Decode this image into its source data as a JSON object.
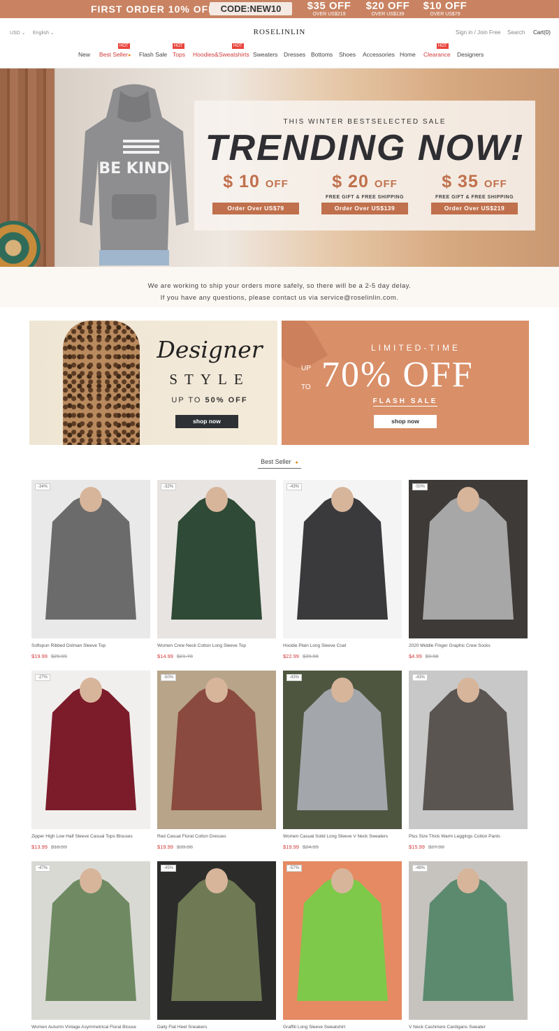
{
  "promo": {
    "first_order": "FIRST ORDER 10% OFF",
    "code": "CODE:NEW10",
    "offers": [
      {
        "amount": "$35 OFF",
        "condition": "OVER US$219"
      },
      {
        "amount": "$20 OFF",
        "condition": "OVER US$139"
      },
      {
        "amount": "$10 OFF",
        "condition": "OVER US$79"
      }
    ]
  },
  "header": {
    "currency": "USD",
    "language": "English",
    "logo": "ROSELINLIN",
    "signin": "Sign in / Join Free",
    "search": "Search",
    "cart": "Cart(0)"
  },
  "nav": {
    "items": [
      {
        "label": "New"
      },
      {
        "label": "Best Seller"
      },
      {
        "label": "Flash Sale"
      },
      {
        "label": "Tops"
      },
      {
        "label": "Hoodies&Sweatshirts"
      },
      {
        "label": "Sweaters"
      },
      {
        "label": "Dresses"
      },
      {
        "label": "Bottoms"
      },
      {
        "label": "Shoes"
      },
      {
        "label": "Accessories"
      },
      {
        "label": "Home"
      },
      {
        "label": "Clearance"
      },
      {
        "label": "Designers"
      }
    ],
    "hot_label": "HOT"
  },
  "hero": {
    "eyebrow": "THIS WINTER BESTSELECTED SALE",
    "title": "TRENDING NOW!",
    "hoodie_text": "BE KIND",
    "deals": [
      {
        "amount": "$ 10",
        "unit": "OFF",
        "note": "",
        "button": "Order Over US$79"
      },
      {
        "amount": "$ 20",
        "unit": "OFF",
        "note": "FREE GIFT & FREE SHIPPING",
        "button": "Order Over US$139"
      },
      {
        "amount": "$ 35",
        "unit": "OFF",
        "note": "FREE GIFT & FREE SHIPPING",
        "button": "Order Over US$219"
      }
    ]
  },
  "notice": {
    "line1": "We are working to ship your orders more safely, so there will be a 2-5 day delay.",
    "line2": "If you have any questions, please contact us via service@roselinlin.com."
  },
  "banner_left": {
    "script": "Designer",
    "style": "STYLE",
    "upto": "UP TO",
    "percent": "50% OFF",
    "button": "shop now"
  },
  "banner_right": {
    "limited": "LIMITED-TIME",
    "up": "UP",
    "to": "TO",
    "percent": "70% OFF",
    "flash": "FLASH SALE",
    "button": "shop now"
  },
  "best_seller": {
    "title": "Best Seller"
  },
  "products": [
    {
      "discount": "-34%",
      "name": "Softspun Ribbed Dolman Sleeve Top",
      "price": "$19.99",
      "old": "$29.99",
      "color": "#6b6b6b",
      "bg": "#e9e9e9"
    },
    {
      "discount": "-32%",
      "name": "Women Crew Neck Cotton Long Sleeve Top",
      "price": "$14.99",
      "old": "$21.78",
      "color": "#2f4a36",
      "bg": "#e8e4e2"
    },
    {
      "discount": "-43%",
      "name": "Hoodie Plain Long Sleeve Coat",
      "price": "$22.99",
      "old": "$39.98",
      "color": "#3a3a3c",
      "bg": "#f4f4f4"
    },
    {
      "discount": "-50%",
      "name": "2020 Middle Finger Graphic Crew Socks",
      "price": "$4.99",
      "old": "$9.98",
      "color": "#a7a7a7",
      "bg": "#3e3a38"
    },
    {
      "discount": "-27%",
      "name": "Zipper High Low Half Sleeve Casual Tops Blouses",
      "price": "$13.99",
      "old": "$18.99",
      "color": "#7c1c2b",
      "bg": "#f1efee"
    },
    {
      "discount": "-50%",
      "name": "Red Casual Floral Cotton Dresses",
      "price": "$19.99",
      "old": "$39.98",
      "color": "#8a4a3f",
      "bg": "#b7a489"
    },
    {
      "discount": "-43%",
      "name": "Women Casual Solid Long Sleeve V Neck Sweaters",
      "price": "$19.99",
      "old": "$24.99",
      "color": "#a3a6aa",
      "bg": "#4e5640"
    },
    {
      "discount": "-43%",
      "name": "Plus Size Thick Warm Leggings Cotton Pants",
      "price": "$15.99",
      "old": "$27.98",
      "color": "#5b5552",
      "bg": "#c8c8c8"
    },
    {
      "discount": "-47%",
      "name": "Women Autumn Vintage Asymmetrical Floral Blouse",
      "price": "",
      "old": "",
      "color": "#6f8a62",
      "bg": "#d9d9d4"
    },
    {
      "discount": "-45%",
      "name": "Daily Flat Heel Sneakers",
      "price": "",
      "old": "",
      "color": "#6f7a55",
      "bg": "#2c2d2a"
    },
    {
      "discount": "-57%",
      "name": "Graffiti Long Sleeve Sweatshirt",
      "price": "",
      "old": "",
      "color": "#7fc94a",
      "bg": "#e58a62"
    },
    {
      "discount": "-48%",
      "name": "V Neck Cashmere Cardigans Sweater",
      "price": "",
      "old": "",
      "color": "#5c8a6f",
      "bg": "#c6c3bf"
    }
  ]
}
